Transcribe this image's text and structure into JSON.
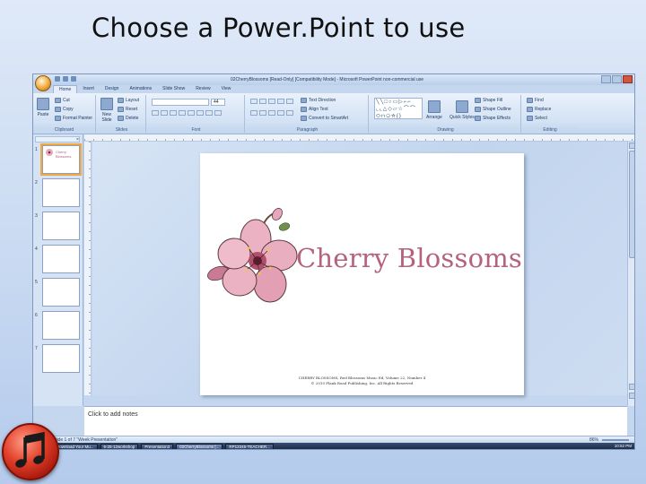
{
  "heading": "Choose a Power.Point to use",
  "window": {
    "title": "02CherryBlossoms [Read-Only] [Compatibility Mode] - Microsoft PowerPoint non-commercial use"
  },
  "ribbon": {
    "tabs": [
      "Home",
      "Insert",
      "Design",
      "Animations",
      "Slide Show",
      "Review",
      "View"
    ],
    "clipboard": {
      "paste": "Paste",
      "cut": "Cut",
      "copy": "Copy",
      "format_painter": "Format Painter",
      "label": "Clipboard"
    },
    "slides": {
      "new_slide": "New Slide",
      "layout": "Layout",
      "reset": "Reset",
      "delete": "Delete",
      "label": "Slides"
    },
    "font": {
      "label": "Font",
      "size": "44"
    },
    "paragraph": {
      "text_direction": "Text Direction",
      "align_text": "Align Text",
      "smartart": "Convert to SmartArt",
      "label": "Paragraph"
    },
    "drawing": {
      "arrange": "Arrange",
      "quick_styles": "Quick Styles",
      "shape_fill": "Shape Fill",
      "shape_outline": "Shape Outline",
      "shape_effects": "Shape Effects",
      "label": "Drawing"
    },
    "editing": {
      "find": "Find",
      "replace": "Replace",
      "select": "Select",
      "label": "Editing"
    }
  },
  "thumbnails": [
    {
      "num": "1",
      "title": "Cherry Blossoms"
    },
    {
      "num": "2",
      "title": ""
    },
    {
      "num": "3",
      "title": ""
    },
    {
      "num": "4",
      "title": ""
    },
    {
      "num": "5",
      "title": ""
    },
    {
      "num": "6",
      "title": ""
    },
    {
      "num": "7",
      "title": ""
    }
  ],
  "slide": {
    "title": "Cherry Blossoms",
    "footer_line1": "CHERRY BLOSSOMS, Red Blossoms Music Ed, Volume 22, Number 4",
    "footer_line2": "© 2010 Plank Road Publishing, Inc. All Rights Reserved"
  },
  "notes_placeholder": "Click to add notes",
  "status": {
    "slide_info": "Slide 1 of 7   \"Week Presentation\"",
    "zoom": "86%"
  },
  "taskbar": {
    "items": [
      "Download Your Mu...",
      "6-25-12workshop",
      "Presentation3",
      "02CherryBlossoms [...",
      "RP12345-TEACHER..."
    ],
    "tray": "10:52 PM"
  },
  "colors": {
    "brand_pink": "#b4627e",
    "ribbon_blue": "#d3e2f4",
    "music_icon_red": "#e2402a"
  }
}
